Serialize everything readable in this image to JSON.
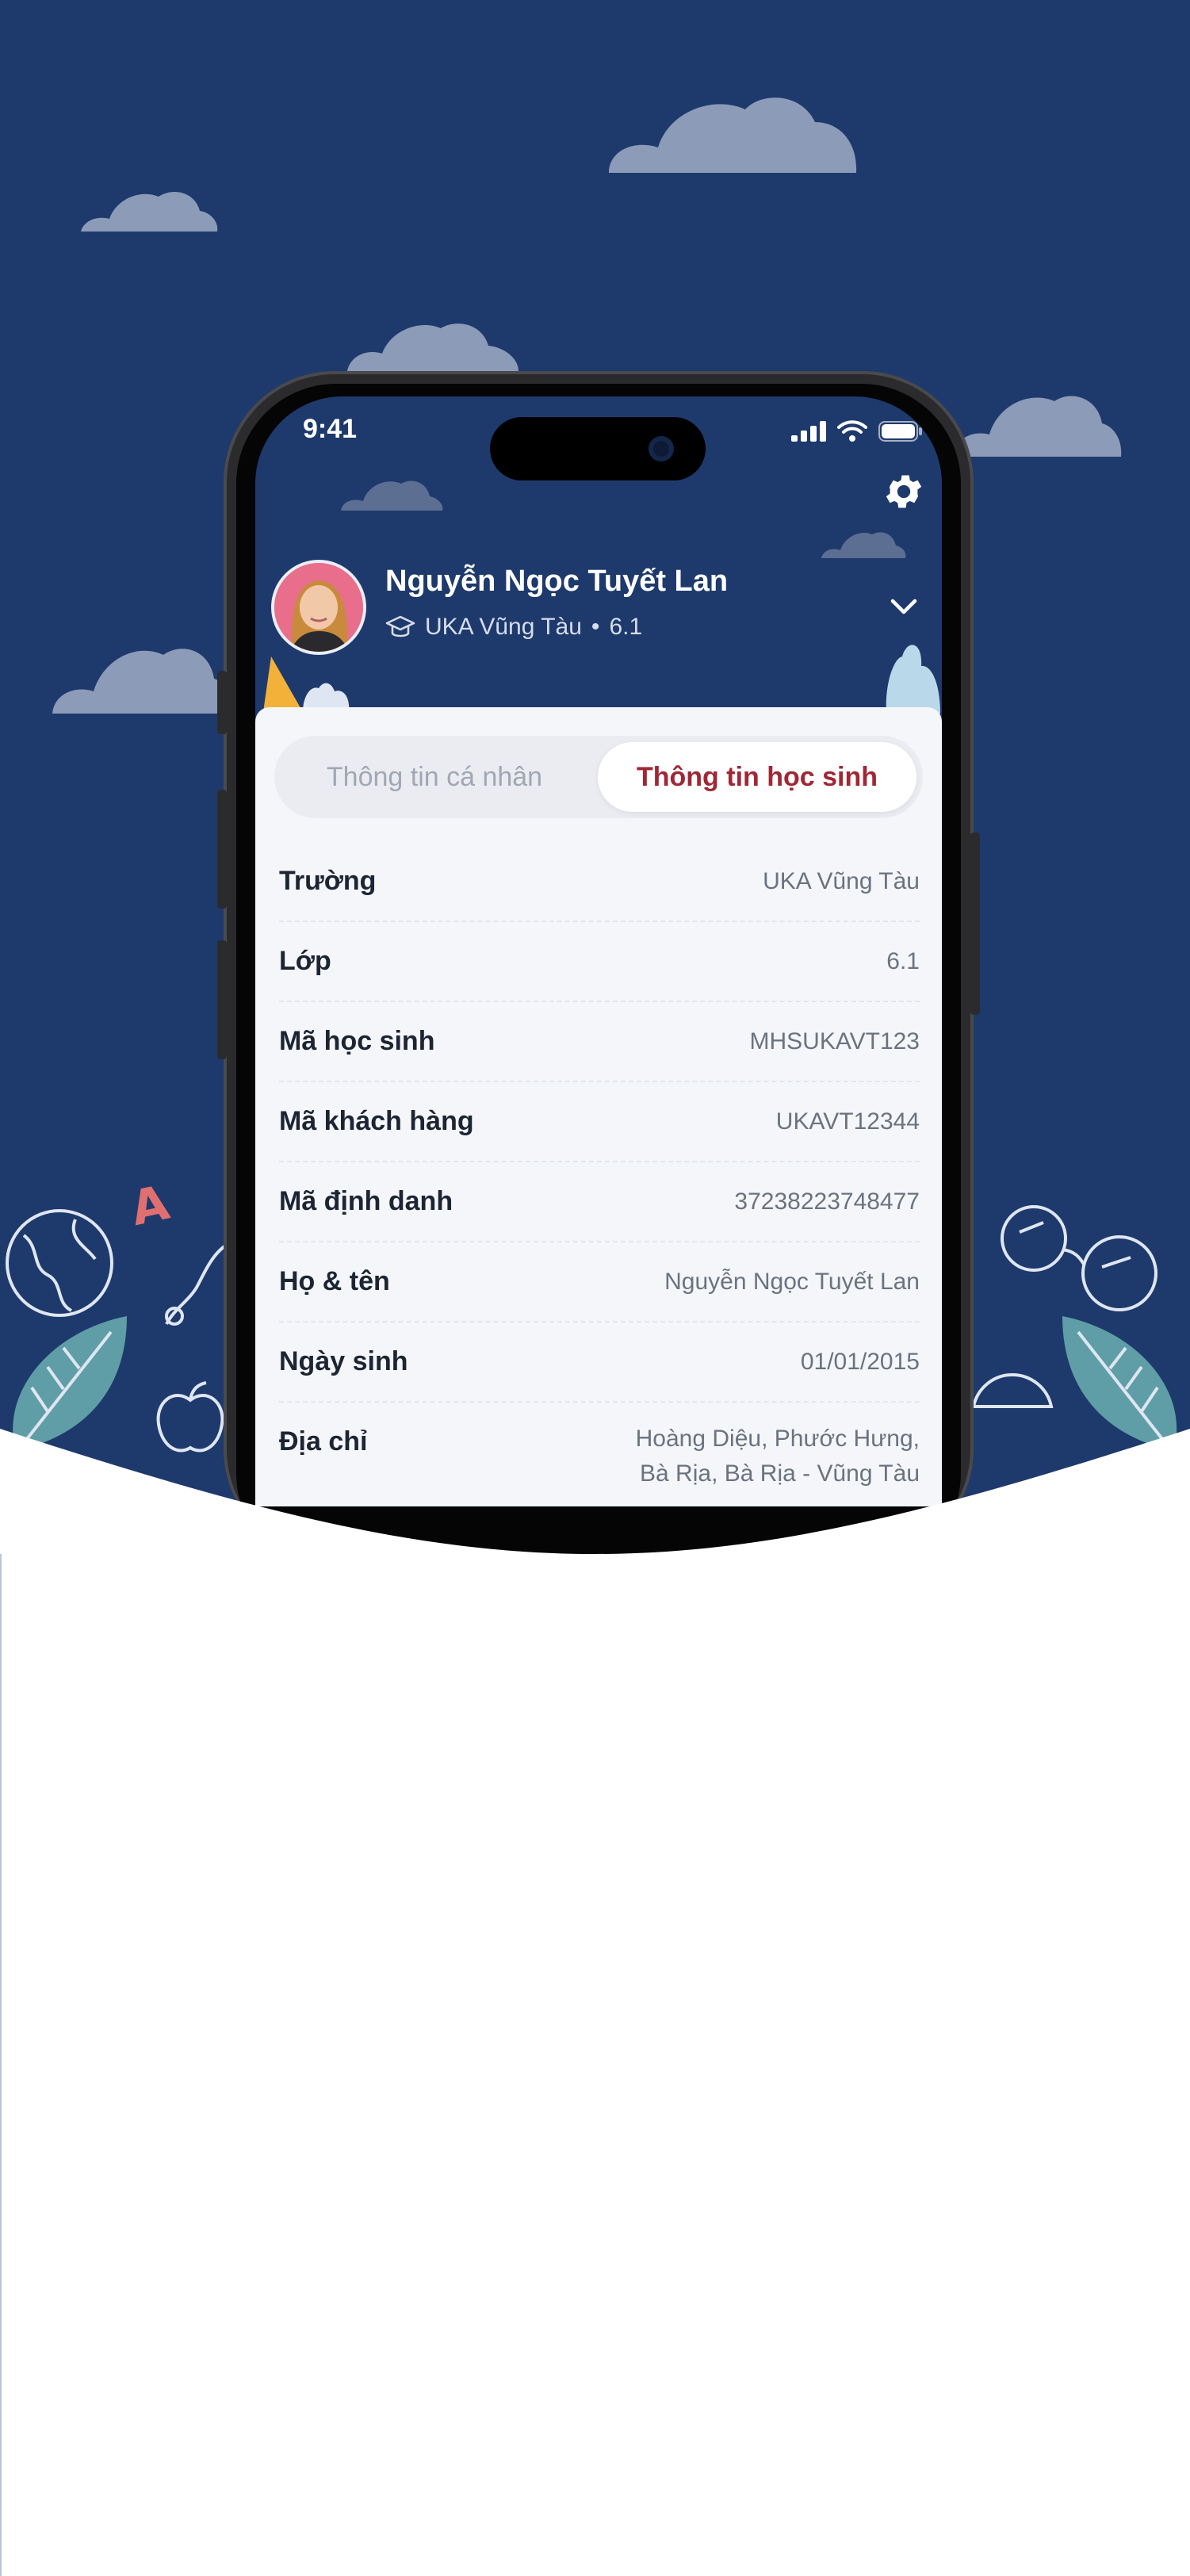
{
  "status_bar": {
    "time": "9:41"
  },
  "profile": {
    "name": "Nguyễn Ngọc Tuyết Lan",
    "school": "UKA Vũng Tàu",
    "separator": "•",
    "class": "6.1"
  },
  "tabs": [
    {
      "label": "Thông tin cá nhân",
      "active": false
    },
    {
      "label": "Thông tin học sinh",
      "active": true
    }
  ],
  "student_info": [
    {
      "label": "Trường",
      "value": "UKA Vũng Tàu"
    },
    {
      "label": "Lớp",
      "value": "6.1"
    },
    {
      "label": "Mã học sinh",
      "value": "MHSUKAVT123"
    },
    {
      "label": "Mã khách hàng",
      "value": "UKAVT12344"
    },
    {
      "label": "Mã định danh",
      "value": "37238223748477"
    },
    {
      "label": "Họ & tên",
      "value": "Nguyễn Ngọc Tuyết Lan"
    },
    {
      "label": "Ngày sinh",
      "value": "01/01/2015"
    },
    {
      "label": "Địa chỉ",
      "value": "Hoàng Diệu, Phước Hưng, Bà Rịa, Bà Rịa - Vũng Tàu"
    }
  ],
  "decor": {
    "letter": "A"
  },
  "colors": {
    "hero_bg": "#1e3a6c",
    "cloud": "#8c9bb8",
    "active_tab_text": "#a02735",
    "leaf": "#5f9ea6"
  }
}
